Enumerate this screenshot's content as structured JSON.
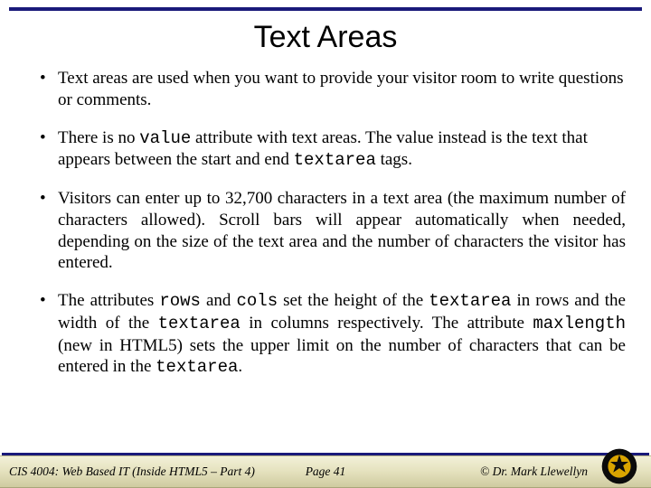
{
  "title": "Text Areas",
  "bullets": {
    "b1": "Text areas are used when you want to provide your visitor room to write questions or comments.",
    "b2_pre": "There is no ",
    "b2_code1": "value",
    "b2_mid": " attribute with text areas.  The value instead is the text that appears between the start and end ",
    "b2_code2": "textarea",
    "b2_post": " tags.",
    "b3": "Visitors can enter up to 32,700 characters in a text area (the maximum number of characters allowed).  Scroll bars will appear automatically when needed, depending on the size of the text area and the number of characters the visitor has entered.",
    "b4_a": "The attributes ",
    "b4_code_rows": "rows",
    "b4_b": " and ",
    "b4_code_cols": "cols",
    "b4_c": " set the height of the ",
    "b4_code_ta1": "textarea",
    "b4_d": " in rows and the width of the ",
    "b4_code_ta2": "textarea",
    "b4_e": " in columns respectively.  The attribute ",
    "b4_code_max": "maxlength",
    "b4_f": " (new in HTML5) sets the upper limit on the number of characters that can be entered in the ",
    "b4_code_ta3": "textarea",
    "b4_g": "."
  },
  "footer": {
    "course": "CIS 4004: Web Based IT (Inside HTML5 – Part 4)",
    "page": "Page 41",
    "copyright": "© Dr. Mark Llewellyn"
  }
}
